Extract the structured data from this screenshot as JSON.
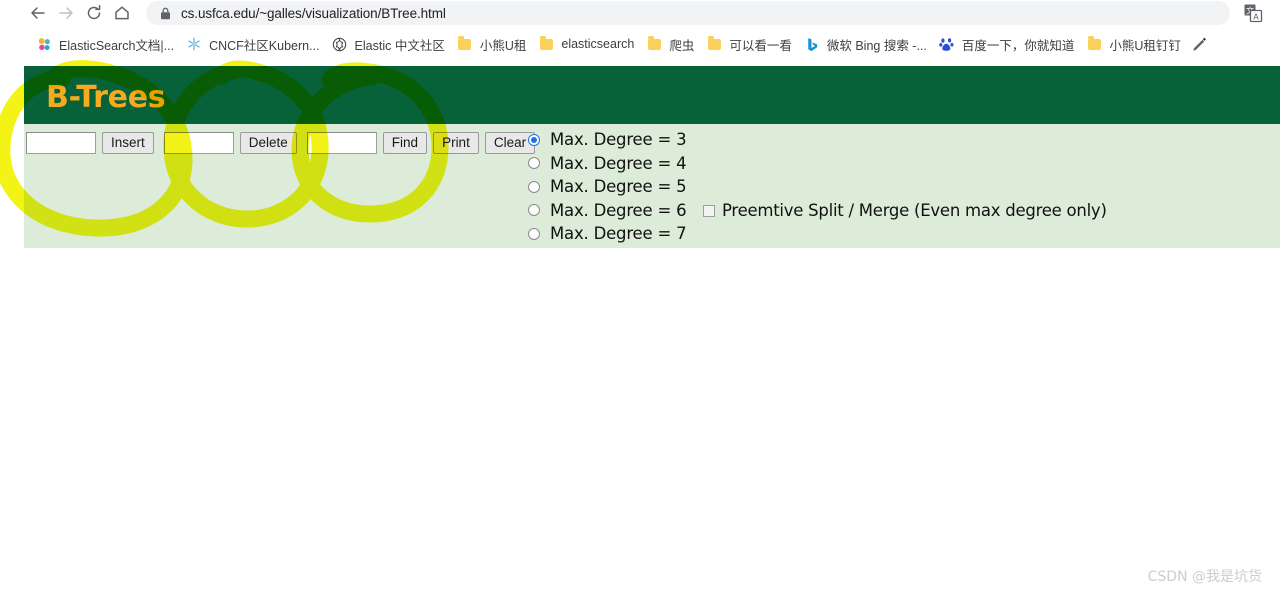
{
  "browser": {
    "nav": {
      "back_label": "Back",
      "forward_label": "Forward",
      "reload_label": "Reload",
      "home_label": "Home"
    },
    "omnibox": {
      "url": "cs.usfca.edu/~galles/visualization/BTree.html",
      "security_icon": "lock-icon"
    },
    "translate_icon": "translate-icon",
    "bookmarks": [
      {
        "label": "ElasticSearch文档|...",
        "icon": "elasticsearch-icon"
      },
      {
        "label": "CNCF社区Kubern...",
        "icon": "snowflake-icon"
      },
      {
        "label": "Elastic 中文社区",
        "icon": "elastic-logo-icon"
      },
      {
        "label": "小熊U租",
        "icon": "folder-icon"
      },
      {
        "label": "elasticsearch",
        "icon": "folder-icon"
      },
      {
        "label": "爬虫",
        "icon": "folder-icon"
      },
      {
        "label": "可以看一看",
        "icon": "folder-icon"
      },
      {
        "label": "微软 Bing 搜索 -...",
        "icon": "bing-icon"
      },
      {
        "label": "百度一下，你就知道",
        "icon": "baidu-icon"
      },
      {
        "label": "小熊U租钉钉",
        "icon": "folder-icon"
      }
    ],
    "bookmarks_overflow_icon": "pen-icon"
  },
  "page": {
    "title": "B-Trees",
    "colors": {
      "header_green": "#076139",
      "panel_green": "#dcecd8",
      "title_gold": "#f5ab21",
      "highlighter_yellow": "#f2f20a",
      "radio_accent": "#1a73e8"
    },
    "controls": {
      "insert_input_value": "",
      "insert_button": "Insert",
      "delete_input_value": "",
      "delete_button": "Delete",
      "find_input_value": "",
      "find_button": "Find",
      "print_button": "Print",
      "clear_button": "Clear"
    },
    "degree_options": [
      {
        "label": "Max. Degree = 3",
        "checked": true
      },
      {
        "label": "Max. Degree = 4",
        "checked": false
      },
      {
        "label": "Max. Degree = 5",
        "checked": false
      },
      {
        "label": "Max. Degree = 6",
        "checked": false
      },
      {
        "label": "Max. Degree = 7",
        "checked": false
      }
    ],
    "preemptive": {
      "label": "Preemtive Split / Merge (Even max degree only)",
      "checked": false
    },
    "annotations": {
      "marker_count": 3,
      "marker_color": "#f2f20a",
      "description": "three hand-drawn yellow highlighter circles over the input/button groups"
    }
  },
  "watermark": "CSDN @我是坑货"
}
